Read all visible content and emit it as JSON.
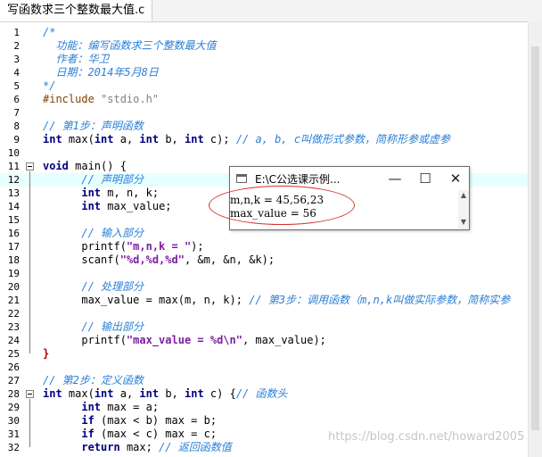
{
  "tab": {
    "title": "写函数求三个整数最大值.c"
  },
  "editor": {
    "lines": [
      {
        "num": "1",
        "tokens": [
          [
            "/*",
            "com"
          ]
        ]
      },
      {
        "num": "2",
        "tokens": [
          [
            "  功能：编写函数求三个整数最大值",
            "com"
          ]
        ]
      },
      {
        "num": "3",
        "tokens": [
          [
            "  作者：华卫",
            "com"
          ]
        ]
      },
      {
        "num": "4",
        "tokens": [
          [
            "  日期：2014年5月8日",
            "com"
          ]
        ]
      },
      {
        "num": "5",
        "tokens": [
          [
            "*/",
            "com"
          ]
        ]
      },
      {
        "num": "6",
        "tokens": [
          [
            "#include ",
            "pp"
          ],
          [
            "\"stdio.h\"",
            "str"
          ]
        ]
      },
      {
        "num": "7",
        "tokens": []
      },
      {
        "num": "8",
        "tokens": [
          [
            "// 第1步：声明函数",
            "com"
          ]
        ]
      },
      {
        "num": "9",
        "tokens": [
          [
            "int",
            "kw"
          ],
          [
            " max(",
            "plain"
          ],
          [
            "int",
            "kw"
          ],
          [
            " a, ",
            "plain"
          ],
          [
            "int",
            "kw"
          ],
          [
            " b, ",
            "plain"
          ],
          [
            "int",
            "kw"
          ],
          [
            " c); ",
            "plain"
          ],
          [
            "// a, b, c叫做形式参数，简称形参或虚参",
            "com"
          ]
        ]
      },
      {
        "num": "10",
        "tokens": []
      },
      {
        "num": "11",
        "fold": true,
        "tokens": [
          [
            "void",
            "kw"
          ],
          [
            " main() {",
            "plain"
          ]
        ]
      },
      {
        "num": "12",
        "hl": true,
        "tokens": [
          [
            "      // 声明部分",
            "com"
          ]
        ]
      },
      {
        "num": "13",
        "tokens": [
          [
            "      ",
            "plain"
          ],
          [
            "int",
            "kw"
          ],
          [
            " m, n, k;",
            "plain"
          ]
        ]
      },
      {
        "num": "14",
        "tokens": [
          [
            "      ",
            "plain"
          ],
          [
            "int",
            "kw"
          ],
          [
            " max_value;",
            "plain"
          ]
        ]
      },
      {
        "num": "15",
        "tokens": []
      },
      {
        "num": "16",
        "tokens": [
          [
            "      // 输入部分",
            "com"
          ]
        ]
      },
      {
        "num": "17",
        "tokens": [
          [
            "      printf(",
            "plain"
          ],
          [
            "\"m,n,k = \"",
            "fstr"
          ],
          [
            ");",
            "plain"
          ]
        ]
      },
      {
        "num": "18",
        "tokens": [
          [
            "      scanf(",
            "plain"
          ],
          [
            "\"%d,%d,%d\"",
            "fstr"
          ],
          [
            ", &m, &n, &k);",
            "plain"
          ]
        ]
      },
      {
        "num": "19",
        "tokens": []
      },
      {
        "num": "20",
        "tokens": [
          [
            "      // 处理部分",
            "com"
          ]
        ]
      },
      {
        "num": "21",
        "tokens": [
          [
            "      max_value = max(m, n, k); ",
            "plain"
          ],
          [
            "// 第3步：调用函数（m,n,k叫做实际参数，简称实参",
            "com"
          ]
        ]
      },
      {
        "num": "22",
        "tokens": []
      },
      {
        "num": "23",
        "tokens": [
          [
            "      // 输出部分",
            "com"
          ]
        ]
      },
      {
        "num": "24",
        "tokens": [
          [
            "      printf(",
            "plain"
          ],
          [
            "\"max_value = %d\\n\"",
            "fstr"
          ],
          [
            ", max_value);",
            "plain"
          ]
        ]
      },
      {
        "num": "25",
        "tokens": [
          [
            "}",
            "red"
          ]
        ]
      },
      {
        "num": "26",
        "tokens": []
      },
      {
        "num": "27",
        "tokens": [
          [
            "// 第2步：定义函数",
            "com"
          ]
        ]
      },
      {
        "num": "28",
        "fold": true,
        "tokens": [
          [
            "int",
            "kw"
          ],
          [
            " max(",
            "plain"
          ],
          [
            "int",
            "kw"
          ],
          [
            " a, ",
            "plain"
          ],
          [
            "int",
            "kw"
          ],
          [
            " b, ",
            "plain"
          ],
          [
            "int",
            "kw"
          ],
          [
            " c) {",
            "plain"
          ],
          [
            "// 函数头",
            "com"
          ]
        ]
      },
      {
        "num": "29",
        "tokens": [
          [
            "      ",
            "plain"
          ],
          [
            "int",
            "kw"
          ],
          [
            " max = a;",
            "plain"
          ]
        ]
      },
      {
        "num": "30",
        "tokens": [
          [
            "      ",
            "plain"
          ],
          [
            "if",
            "kw"
          ],
          [
            " (max < b) max = b;",
            "plain"
          ]
        ]
      },
      {
        "num": "31",
        "tokens": [
          [
            "      ",
            "plain"
          ],
          [
            "if",
            "kw"
          ],
          [
            " (max < c) max = c;",
            "plain"
          ]
        ]
      },
      {
        "num": "32",
        "tokens": [
          [
            "      ",
            "plain"
          ],
          [
            "return",
            "kw"
          ],
          [
            " max; ",
            "plain"
          ],
          [
            "// 返回函数值",
            "com"
          ]
        ]
      }
    ]
  },
  "console": {
    "title": "E:\\C公选课示例...",
    "minimize": "—",
    "maximize": "☐",
    "close": "✕",
    "output": [
      "m,n,k = 45,56,23",
      "max_value = 56"
    ]
  },
  "watermark": "https://blog.csdn.net/howard2005"
}
